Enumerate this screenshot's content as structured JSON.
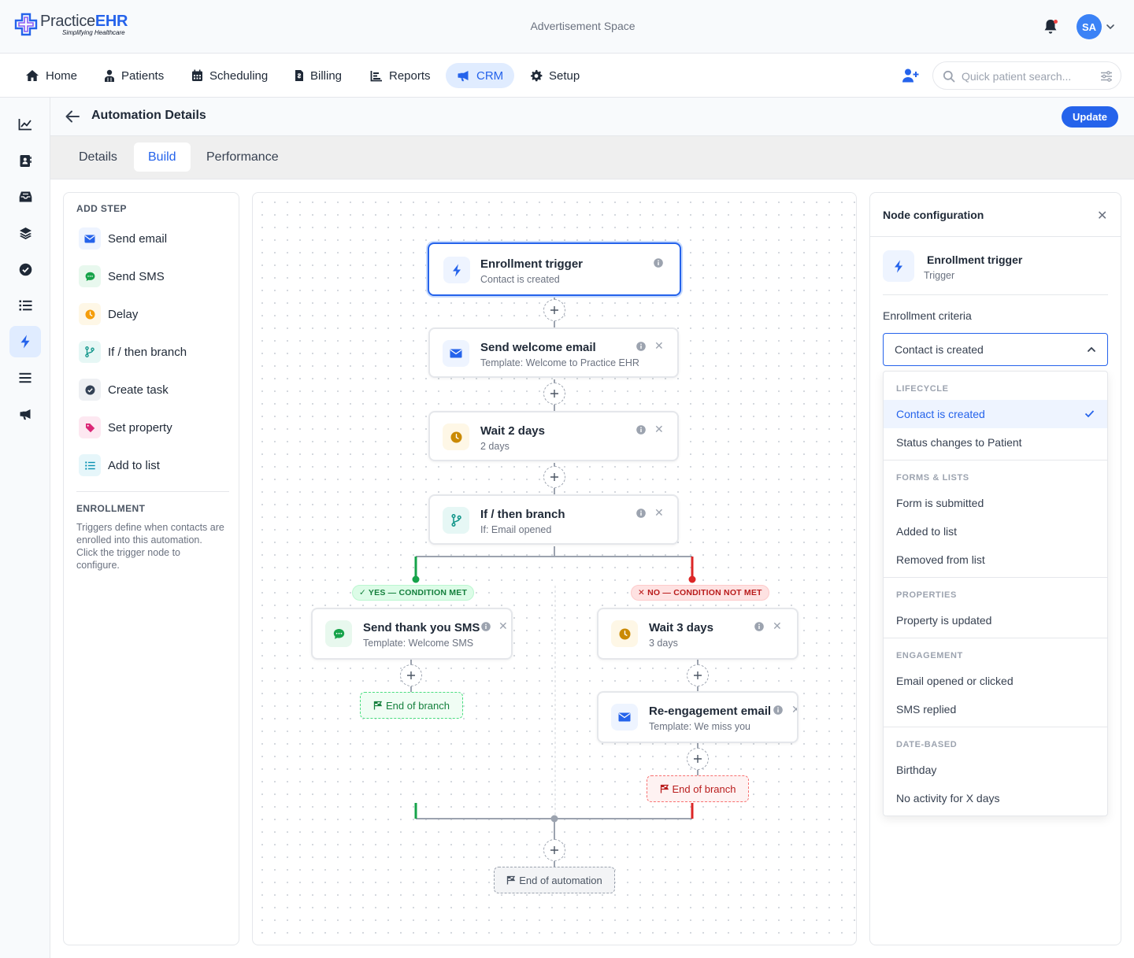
{
  "header": {
    "logo_name_a": "Practice",
    "logo_name_b": "EHR",
    "logo_tagline": "Simplifying Healthcare",
    "ad_space": "Advertisement Space",
    "avatar_initials": "SA"
  },
  "nav": {
    "items": [
      "Home",
      "Patients",
      "Scheduling",
      "Billing",
      "Reports",
      "CRM",
      "Setup"
    ],
    "active": "CRM",
    "search_placeholder": "Quick patient search..."
  },
  "page": {
    "title": "Automation Details",
    "update_label": "Update",
    "tabs": [
      "Details",
      "Build",
      "Performance"
    ],
    "active_tab": "Build"
  },
  "steps_panel": {
    "add_step_label": "ADD STEP",
    "steps": [
      {
        "label": "Send email",
        "icon": "envelope-icon",
        "color": "#2563eb",
        "bg": "#eef4ff"
      },
      {
        "label": "Send SMS",
        "icon": "chat-bubble-icon",
        "color": "#16a34a",
        "bg": "#e8f8ee"
      },
      {
        "label": "Delay",
        "icon": "clock-icon",
        "color": "#f59e0b",
        "bg": "#fef7e6"
      },
      {
        "label": "If / then branch",
        "icon": "branch-icon",
        "color": "#0d9488",
        "bg": "#e6f7f5"
      },
      {
        "label": "Create task",
        "icon": "check-circle-icon",
        "color": "#334155",
        "bg": "#eef0f3"
      },
      {
        "label": "Set property",
        "icon": "tag-icon",
        "color": "#db2777",
        "bg": "#fde8f1"
      },
      {
        "label": "Add to list",
        "icon": "list-icon",
        "color": "#0891b2",
        "bg": "#e6f6fa"
      }
    ],
    "enrollment_label": "ENROLLMENT",
    "enrollment_text": "Triggers define when contacts are enrolled into this automation. Click the trigger node to configure."
  },
  "canvas": {
    "trigger": {
      "title": "Enrollment trigger",
      "subtitle": "Contact is created"
    },
    "welcome": {
      "title": "Send welcome email",
      "subtitle": "Template: Welcome to Practice EHR"
    },
    "wait2": {
      "title": "Wait 2 days",
      "subtitle": "2 days"
    },
    "branch": {
      "title": "If / then branch",
      "subtitle": "If: Email opened"
    },
    "yes_badge": "✓ YES — CONDITION MET",
    "no_badge": "✕ NO — CONDITION NOT MET",
    "thanks_sms": {
      "title": "Send thank you SMS",
      "subtitle": "Template: Welcome SMS"
    },
    "wait3": {
      "title": "Wait 3 days",
      "subtitle": "3 days"
    },
    "reengage": {
      "title": "Re-engagement email",
      "subtitle": "Template: We miss you"
    },
    "end_branch_yes": "End of branch",
    "end_branch_no": "End of branch",
    "end_automation": "End of automation",
    "colors": {
      "yes": "#16a34a",
      "no": "#dc2626",
      "wire": "#9ca3af"
    }
  },
  "config": {
    "title": "Node configuration",
    "node_title": "Enrollment trigger",
    "node_type": "Trigger",
    "criteria_label": "Enrollment criteria",
    "selected_value": "Contact is created",
    "groups": {
      "lifecycle": "LIFECYCLE",
      "forms": "FORMS & LISTS",
      "properties": "PROPERTIES",
      "engagement": "ENGAGEMENT",
      "date": "DATE-BASED"
    },
    "options": {
      "contact_created": "Contact is created",
      "status_changes": "Status changes to Patient",
      "form_submitted": "Form is submitted",
      "added_to_list": "Added to list",
      "removed_from_list": "Removed from list",
      "property_updated": "Property is updated",
      "email_opened": "Email opened or clicked",
      "sms_replied": "SMS replied",
      "birthday": "Birthday",
      "no_activity": "No activity for X days"
    }
  }
}
